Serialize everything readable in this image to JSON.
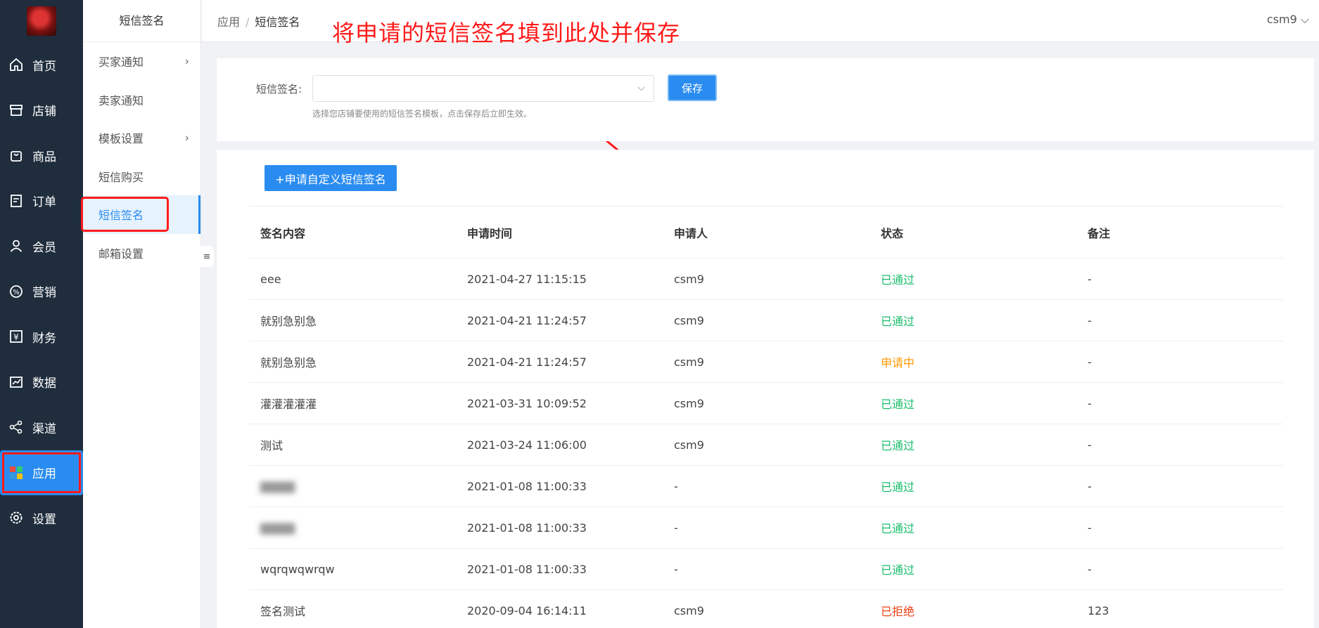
{
  "nav": {
    "items": [
      {
        "label": "首页",
        "icon": "home-icon"
      },
      {
        "label": "店铺",
        "icon": "store-icon"
      },
      {
        "label": "商品",
        "icon": "bag-icon"
      },
      {
        "label": "订单",
        "icon": "order-icon"
      },
      {
        "label": "会员",
        "icon": "user-icon"
      },
      {
        "label": "营销",
        "icon": "marketing-icon"
      },
      {
        "label": "财务",
        "icon": "yen-icon"
      },
      {
        "label": "数据",
        "icon": "chart-icon"
      },
      {
        "label": "渠道",
        "icon": "share-icon"
      },
      {
        "label": "应用",
        "icon": "apps-icon"
      },
      {
        "label": "设置",
        "icon": "gear-icon"
      }
    ],
    "active_index": 9
  },
  "submenu": {
    "title": "短信签名",
    "items": [
      {
        "label": "买家通知",
        "has_children": true
      },
      {
        "label": "卖家通知",
        "has_children": false
      },
      {
        "label": "模板设置",
        "has_children": true
      },
      {
        "label": "短信购买",
        "has_children": false
      },
      {
        "label": "短信签名",
        "has_children": false
      },
      {
        "label": "邮箱设置",
        "has_children": false
      }
    ],
    "active_index": 4
  },
  "breadcrumb": {
    "parent": "应用",
    "separator": "/",
    "current": "短信签名"
  },
  "annotation": "将申请的短信签名填到此处并保存",
  "user": {
    "name": "csm9"
  },
  "form": {
    "label": "短信签名:",
    "select_value": "",
    "save_label": "保存",
    "help": "选择您店铺要使用的短信签名模板，点击保存后立即生效。"
  },
  "apply_button": "+申请自定义短信签名",
  "table": {
    "headers": [
      "签名内容",
      "申请时间",
      "申请人",
      "状态",
      "备注"
    ],
    "rows": [
      {
        "content": "eee",
        "time": "2021-04-27 11:15:15",
        "applicant": "csm9",
        "status": "已通过",
        "status_type": "ok",
        "note": "-"
      },
      {
        "content": "就别急别急",
        "time": "2021-04-21 11:24:57",
        "applicant": "csm9",
        "status": "已通过",
        "status_type": "ok",
        "note": "-"
      },
      {
        "content": "就别急别急",
        "time": "2021-04-21 11:24:57",
        "applicant": "csm9",
        "status": "申请中",
        "status_type": "pending",
        "note": "-"
      },
      {
        "content": "灌灌灌灌灌",
        "time": "2021-03-31 10:09:52",
        "applicant": "csm9",
        "status": "已通过",
        "status_type": "ok",
        "note": "-"
      },
      {
        "content": "测试",
        "time": "2021-03-24 11:06:00",
        "applicant": "csm9",
        "status": "已通过",
        "status_type": "ok",
        "note": "-"
      },
      {
        "content": "",
        "time": "2021-01-08 11:00:33",
        "applicant": "-",
        "status": "已通过",
        "status_type": "ok",
        "note": "-"
      },
      {
        "content": "",
        "time": "2021-01-08 11:00:33",
        "applicant": "-",
        "status": "已通过",
        "status_type": "ok",
        "note": "-"
      },
      {
        "content": "wqrqwqwrqw",
        "time": "2021-01-08 11:00:33",
        "applicant": "-",
        "status": "已通过",
        "status_type": "ok",
        "note": "-"
      },
      {
        "content": "签名测试",
        "time": "2020-09-04 16:14:11",
        "applicant": "csm9",
        "status": "已拒绝",
        "status_type": "rejected",
        "note": "123"
      }
    ]
  },
  "colors": {
    "primary": "#2a8cf0",
    "ok": "#19be6b",
    "pending": "#ff9900",
    "rejected": "#ed4014",
    "annotation": "#ff1a1a",
    "nav_bg": "#1f2d3d"
  }
}
